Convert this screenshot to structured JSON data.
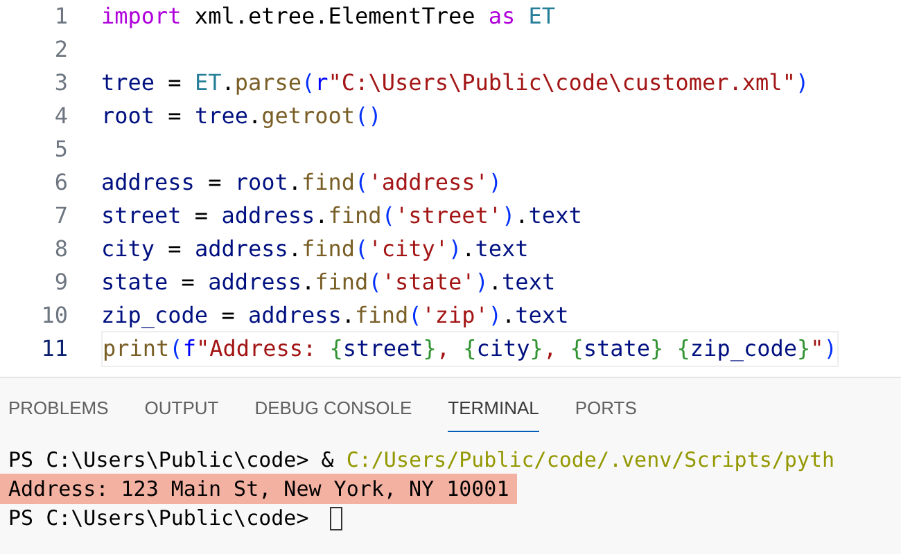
{
  "editor": {
    "lines": [
      {
        "number": "1",
        "current": false,
        "tokens": [
          {
            "text": "import",
            "kind": "keyword"
          },
          {
            "text": " xml.etree.ElementTree ",
            "kind": "plain"
          },
          {
            "text": "as",
            "kind": "keyword"
          },
          {
            "text": " ET",
            "kind": "class"
          }
        ]
      },
      {
        "number": "2",
        "current": false
      },
      {
        "number": "3",
        "current": false,
        "tokens": [
          {
            "text": "tree",
            "kind": "variable"
          },
          {
            "text": " = ",
            "kind": "plain"
          },
          {
            "text": "ET",
            "kind": "class"
          },
          {
            "text": ".",
            "kind": "plain"
          },
          {
            "text": "parse",
            "kind": "function"
          },
          {
            "text": "(",
            "kind": "bracket"
          },
          {
            "text": "r",
            "kind": "prefix"
          },
          {
            "text": "\"C:\\Users\\Public\\code\\customer.xml\"",
            "kind": "string"
          },
          {
            "text": ")",
            "kind": "bracket"
          }
        ]
      },
      {
        "number": "4",
        "current": false,
        "tokens": [
          {
            "text": "root",
            "kind": "variable"
          },
          {
            "text": " = ",
            "kind": "plain"
          },
          {
            "text": "tree",
            "kind": "variable"
          },
          {
            "text": ".",
            "kind": "plain"
          },
          {
            "text": "getroot",
            "kind": "function"
          },
          {
            "text": "()",
            "kind": "bracket"
          }
        ]
      },
      {
        "number": "5",
        "current": false
      },
      {
        "number": "6",
        "current": false,
        "tokens": [
          {
            "text": "address",
            "kind": "variable"
          },
          {
            "text": " = ",
            "kind": "plain"
          },
          {
            "text": "root",
            "kind": "variable"
          },
          {
            "text": ".",
            "kind": "plain"
          },
          {
            "text": "find",
            "kind": "function"
          },
          {
            "text": "(",
            "kind": "bracket"
          },
          {
            "text": "'address'",
            "kind": "string"
          },
          {
            "text": ")",
            "kind": "bracket"
          }
        ]
      },
      {
        "number": "7",
        "current": false,
        "tokens": [
          {
            "text": "street",
            "kind": "variable"
          },
          {
            "text": " = ",
            "kind": "plain"
          },
          {
            "text": "address",
            "kind": "variable"
          },
          {
            "text": ".",
            "kind": "plain"
          },
          {
            "text": "find",
            "kind": "function"
          },
          {
            "text": "(",
            "kind": "bracket"
          },
          {
            "text": "'street'",
            "kind": "string"
          },
          {
            "text": ")",
            "kind": "bracket"
          },
          {
            "text": ".",
            "kind": "plain"
          },
          {
            "text": "text",
            "kind": "variable"
          }
        ]
      },
      {
        "number": "8",
        "current": false,
        "tokens": [
          {
            "text": "city",
            "kind": "variable"
          },
          {
            "text": " = ",
            "kind": "plain"
          },
          {
            "text": "address",
            "kind": "variable"
          },
          {
            "text": ".",
            "kind": "plain"
          },
          {
            "text": "find",
            "kind": "function"
          },
          {
            "text": "(",
            "kind": "bracket"
          },
          {
            "text": "'city'",
            "kind": "string"
          },
          {
            "text": ")",
            "kind": "bracket"
          },
          {
            "text": ".",
            "kind": "plain"
          },
          {
            "text": "text",
            "kind": "variable"
          }
        ]
      },
      {
        "number": "9",
        "current": false,
        "tokens": [
          {
            "text": "state",
            "kind": "variable"
          },
          {
            "text": " = ",
            "kind": "plain"
          },
          {
            "text": "address",
            "kind": "variable"
          },
          {
            "text": ".",
            "kind": "plain"
          },
          {
            "text": "find",
            "kind": "function"
          },
          {
            "text": "(",
            "kind": "bracket"
          },
          {
            "text": "'state'",
            "kind": "string"
          },
          {
            "text": ")",
            "kind": "bracket"
          },
          {
            "text": ".",
            "kind": "plain"
          },
          {
            "text": "text",
            "kind": "variable"
          }
        ]
      },
      {
        "number": "10",
        "current": false,
        "tokens": [
          {
            "text": "zip_code",
            "kind": "variable"
          },
          {
            "text": " = ",
            "kind": "plain"
          },
          {
            "text": "address",
            "kind": "variable"
          },
          {
            "text": ".",
            "kind": "plain"
          },
          {
            "text": "find",
            "kind": "function"
          },
          {
            "text": "(",
            "kind": "bracket"
          },
          {
            "text": "'zip'",
            "kind": "string"
          },
          {
            "text": ")",
            "kind": "bracket"
          },
          {
            "text": ".",
            "kind": "plain"
          },
          {
            "text": "text",
            "kind": "variable"
          }
        ]
      },
      {
        "number": "11",
        "current": true,
        "tokens": [
          {
            "text": "print",
            "kind": "function"
          },
          {
            "text": "(",
            "kind": "bracket"
          },
          {
            "text": "f",
            "kind": "prefix"
          },
          {
            "text": "\"Address: ",
            "kind": "string"
          },
          {
            "text": "{",
            "kind": "interp"
          },
          {
            "text": "street",
            "kind": "variable"
          },
          {
            "text": "}",
            "kind": "interp"
          },
          {
            "text": ", ",
            "kind": "string"
          },
          {
            "text": "{",
            "kind": "interp"
          },
          {
            "text": "city",
            "kind": "variable"
          },
          {
            "text": "}",
            "kind": "interp"
          },
          {
            "text": ", ",
            "kind": "string"
          },
          {
            "text": "{",
            "kind": "interp"
          },
          {
            "text": "state",
            "kind": "variable"
          },
          {
            "text": "}",
            "kind": "interp"
          },
          {
            "text": " {",
            "kind": "interp"
          },
          {
            "text": "zip_code",
            "kind": "variable"
          },
          {
            "text": "}",
            "kind": "interp"
          },
          {
            "text": "\"",
            "kind": "string"
          },
          {
            "text": ")",
            "kind": "bracket"
          }
        ]
      }
    ]
  },
  "panel": {
    "tabs": [
      {
        "label": "PROBLEMS",
        "selected": false
      },
      {
        "label": "OUTPUT",
        "selected": false
      },
      {
        "label": "DEBUG CONSOLE",
        "selected": false
      },
      {
        "label": "TERMINAL",
        "selected": true
      },
      {
        "label": "PORTS",
        "selected": false
      }
    ],
    "terminal": [
      {
        "highlighted": false,
        "segments": [
          {
            "text": "PS C:\\Users\\Public\\code> & ",
            "kind": "plain"
          },
          {
            "text": "C:/Users/Public/code/.venv/Scripts/pyth",
            "kind": "path"
          }
        ]
      },
      {
        "highlighted": true,
        "segments": [
          {
            "text": "Address: 123 Main St, New York, NY 10001",
            "kind": "plain"
          }
        ]
      },
      {
        "highlighted": false,
        "cursor": true,
        "segments": [
          {
            "text": "PS C:\\Users\\Public\\code> ",
            "kind": "plain"
          }
        ]
      }
    ]
  }
}
